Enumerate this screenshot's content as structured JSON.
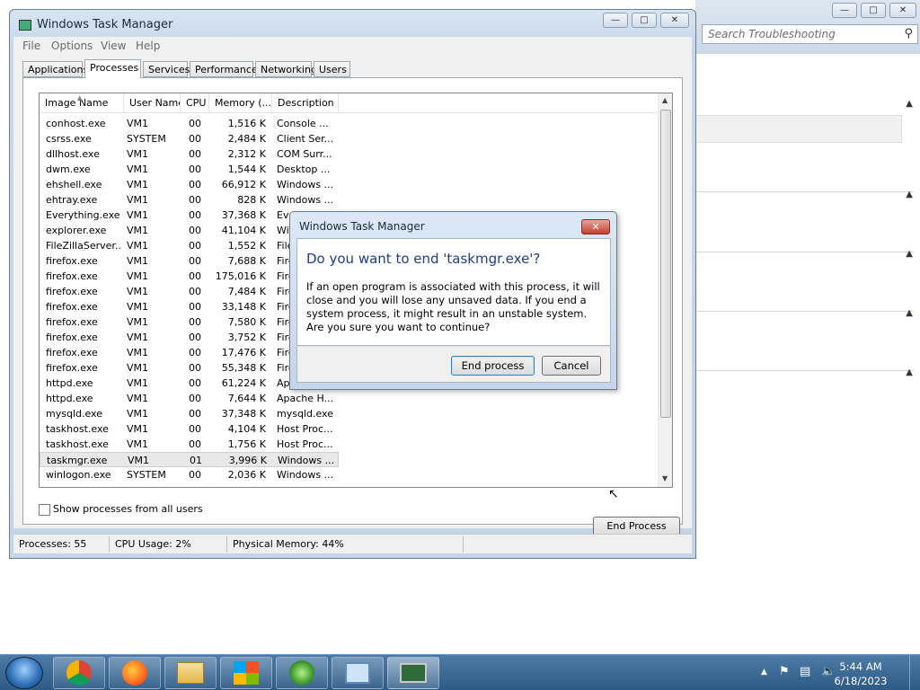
{
  "bg_window": {
    "search_placeholder": "Search Troubleshooting"
  },
  "window": {
    "title": "Windows Task Manager",
    "min_label": "—",
    "max_label": "□",
    "close_label": "✕"
  },
  "menu": {
    "items": [
      "File",
      "Options",
      "View",
      "Help"
    ]
  },
  "tabs": [
    "Applications",
    "Processes",
    "Services",
    "Performance",
    "Networking",
    "Users"
  ],
  "columns": [
    "Image Name",
    "User Name",
    "CPU",
    "Memory (...",
    "Description"
  ],
  "processes": [
    {
      "name": "conhost.exe",
      "user": "VM1",
      "cpu": "00",
      "mem": "1,516 K",
      "desc": "Console ..."
    },
    {
      "name": "csrss.exe",
      "user": "SYSTEM",
      "cpu": "00",
      "mem": "2,484 K",
      "desc": "Client Ser..."
    },
    {
      "name": "dllhost.exe",
      "user": "VM1",
      "cpu": "00",
      "mem": "2,312 K",
      "desc": "COM Surr..."
    },
    {
      "name": "dwm.exe",
      "user": "VM1",
      "cpu": "00",
      "mem": "1,544 K",
      "desc": "Desktop ..."
    },
    {
      "name": "ehshell.exe",
      "user": "VM1",
      "cpu": "00",
      "mem": "66,912 K",
      "desc": "Windows ..."
    },
    {
      "name": "ehtray.exe",
      "user": "VM1",
      "cpu": "00",
      "mem": "828 K",
      "desc": "Windows ..."
    },
    {
      "name": "Everything.exe",
      "user": "VM1",
      "cpu": "00",
      "mem": "37,368 K",
      "desc": "Eve"
    },
    {
      "name": "explorer.exe",
      "user": "VM1",
      "cpu": "00",
      "mem": "41,104 K",
      "desc": "Win"
    },
    {
      "name": "FileZillaServer...",
      "user": "VM1",
      "cpu": "00",
      "mem": "1,552 K",
      "desc": "File"
    },
    {
      "name": "firefox.exe",
      "user": "VM1",
      "cpu": "00",
      "mem": "7,688 K",
      "desc": "Fire"
    },
    {
      "name": "firefox.exe",
      "user": "VM1",
      "cpu": "00",
      "mem": "175,016 K",
      "desc": "Fire"
    },
    {
      "name": "firefox.exe",
      "user": "VM1",
      "cpu": "00",
      "mem": "7,484 K",
      "desc": "Fire"
    },
    {
      "name": "firefox.exe",
      "user": "VM1",
      "cpu": "00",
      "mem": "33,148 K",
      "desc": "Fire"
    },
    {
      "name": "firefox.exe",
      "user": "VM1",
      "cpu": "00",
      "mem": "7,580 K",
      "desc": "Fire"
    },
    {
      "name": "firefox.exe",
      "user": "VM1",
      "cpu": "00",
      "mem": "3,752 K",
      "desc": "Fire"
    },
    {
      "name": "firefox.exe",
      "user": "VM1",
      "cpu": "00",
      "mem": "17,476 K",
      "desc": "Fire"
    },
    {
      "name": "firefox.exe",
      "user": "VM1",
      "cpu": "00",
      "mem": "55,348 K",
      "desc": "Fire"
    },
    {
      "name": "httpd.exe",
      "user": "VM1",
      "cpu": "00",
      "mem": "61,224 K",
      "desc": "Apa"
    },
    {
      "name": "httpd.exe",
      "user": "VM1",
      "cpu": "00",
      "mem": "7,644 K",
      "desc": "Apache H..."
    },
    {
      "name": "mysqld.exe",
      "user": "VM1",
      "cpu": "00",
      "mem": "37,348 K",
      "desc": "mysqld.exe"
    },
    {
      "name": "taskhost.exe",
      "user": "VM1",
      "cpu": "00",
      "mem": "4,104 K",
      "desc": "Host Proc..."
    },
    {
      "name": "taskhost.exe",
      "user": "VM1",
      "cpu": "00",
      "mem": "1,756 K",
      "desc": "Host Proc..."
    },
    {
      "name": "taskmgr.exe",
      "user": "VM1",
      "cpu": "01",
      "mem": "3,996 K",
      "desc": "Windows ...",
      "selected": true
    },
    {
      "name": "winlogon.exe",
      "user": "SYSTEM",
      "cpu": "00",
      "mem": "2,036 K",
      "desc": "Windows ..."
    }
  ],
  "show_all_label": "Show processes from all users",
  "end_process_label": "End Process",
  "status": {
    "processes": "Processes: 55",
    "cpu": "CPU Usage: 2%",
    "memory": "Physical Memory: 44%"
  },
  "dialog": {
    "title": "Windows Task Manager",
    "close_label": "✕",
    "question": "Do you want to end 'taskmgr.exe'?",
    "message": "If an open program is associated with this process, it will close and you will lose any unsaved data. If you end a system process, it might result in an unstable system. Are you sure you want to continue?",
    "confirm_label": "End process",
    "cancel_label": "Cancel"
  },
  "taskbar": {
    "apps": [
      "chrome-icon",
      "firefox-icon",
      "explorer-folder-icon",
      "windows-flag-icon",
      "windows-orb-icon",
      "network-config-icon",
      "task-manager-icon"
    ],
    "time": "5:44 AM",
    "date": "6/18/2023"
  }
}
